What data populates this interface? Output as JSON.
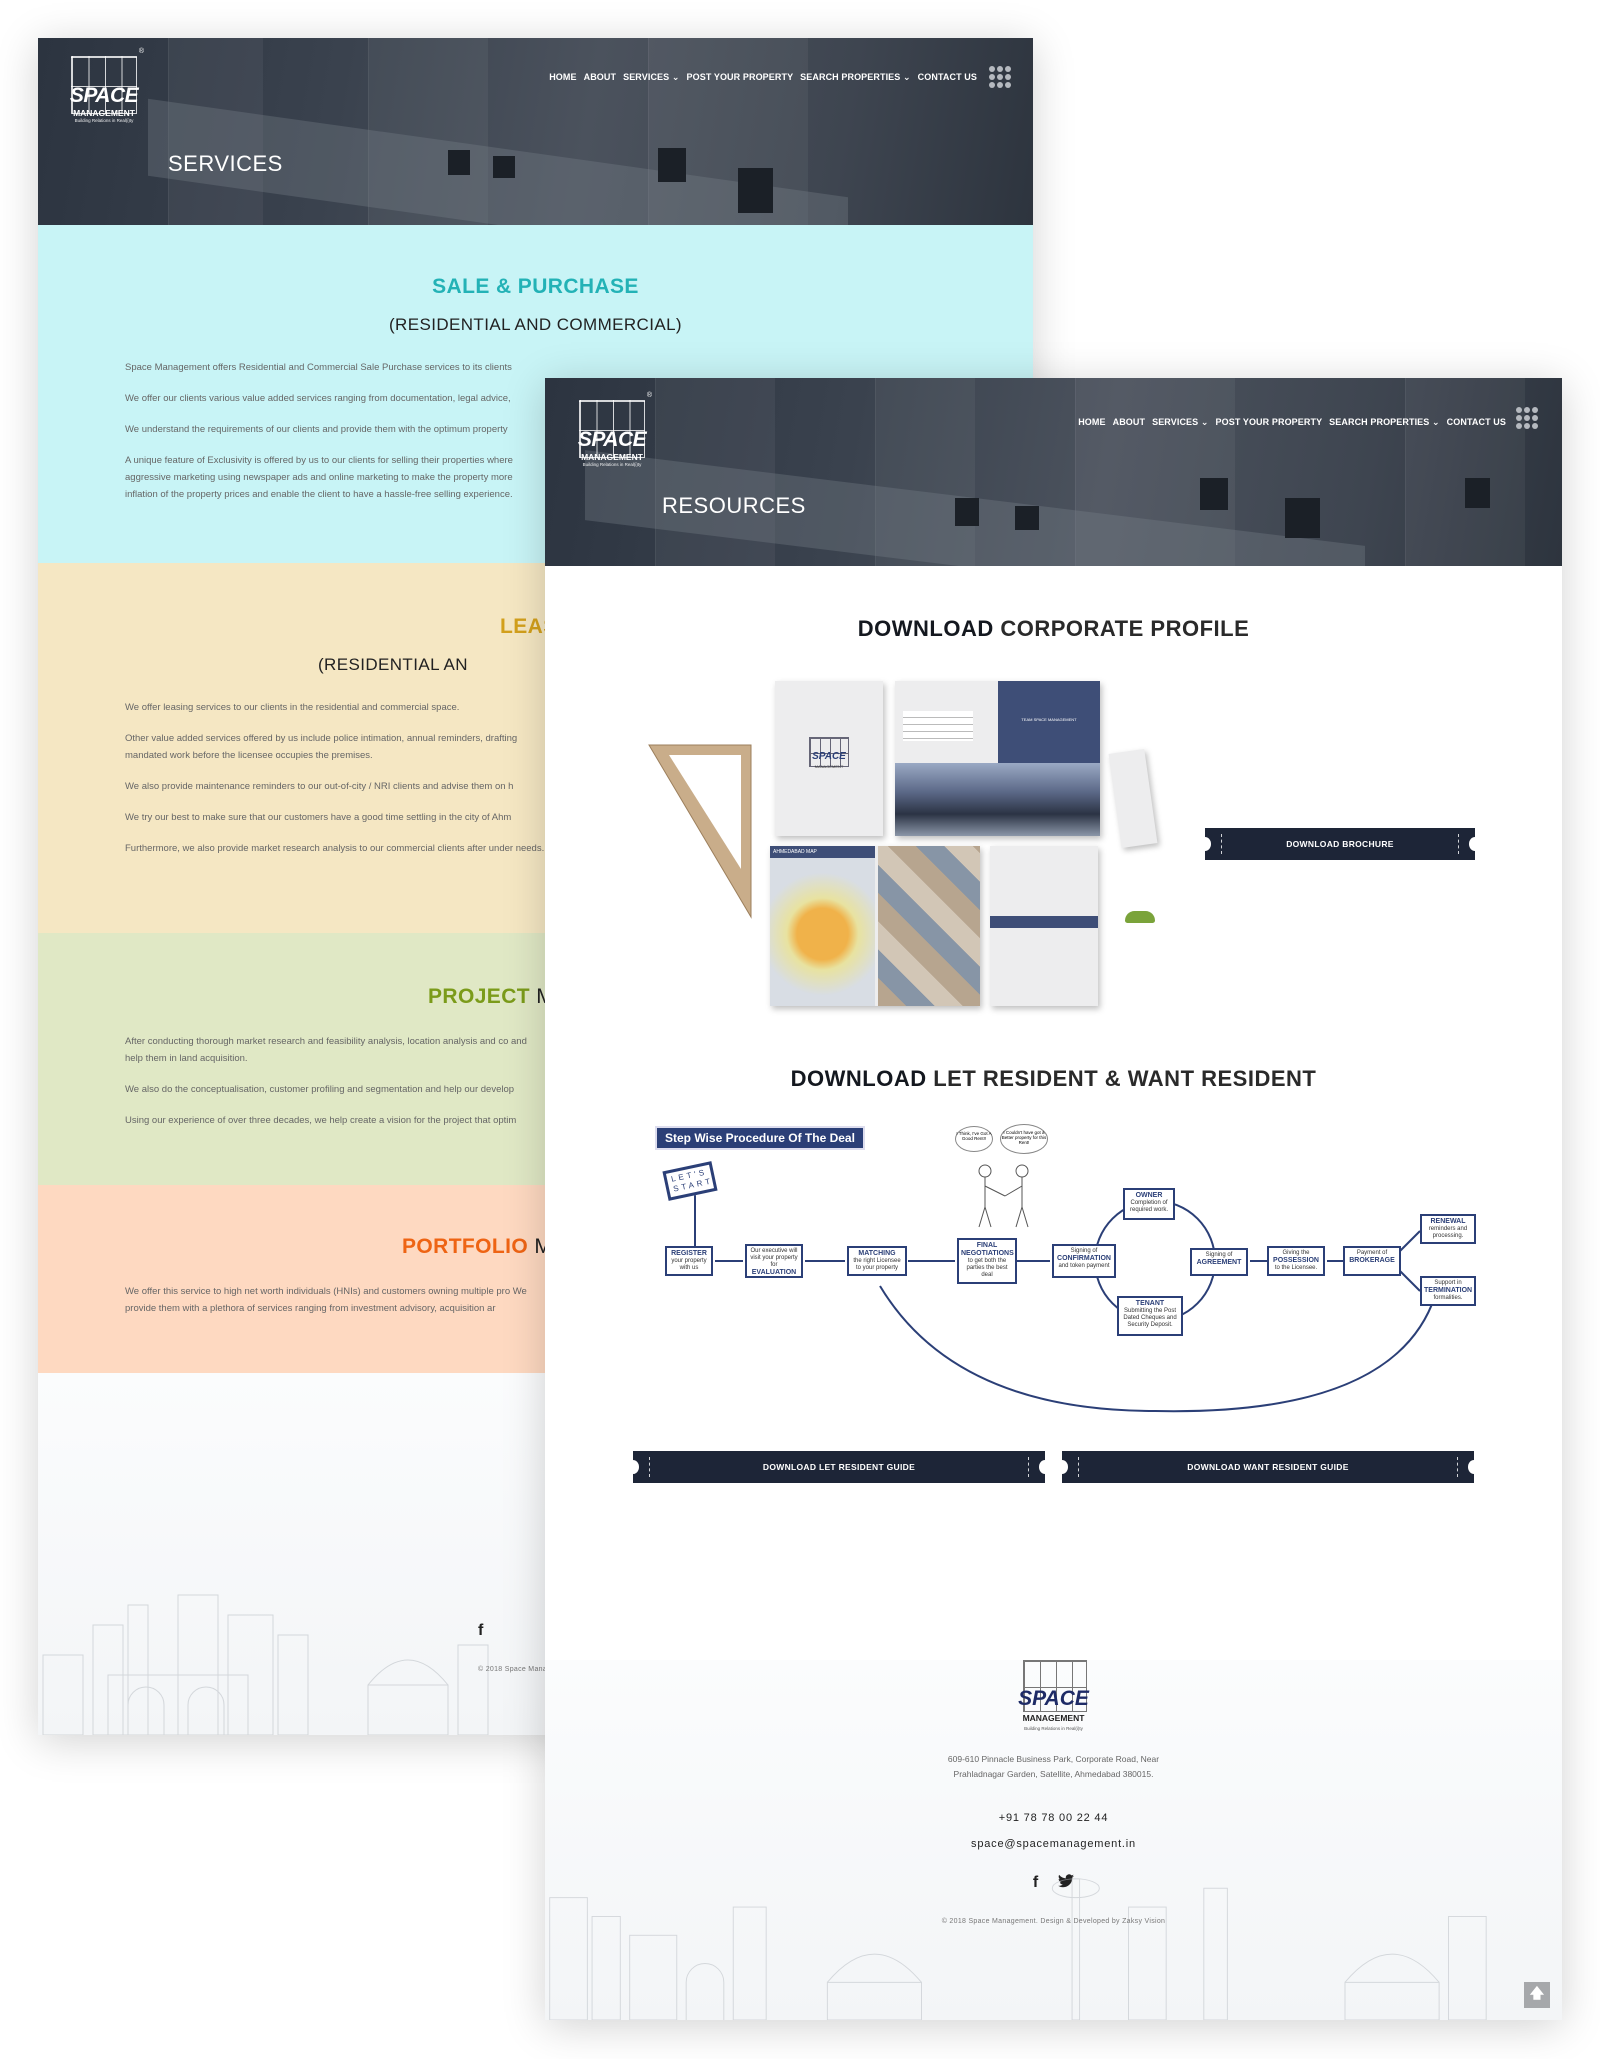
{
  "brand": {
    "name": "SPACE",
    "sub": "MANAGEMENT",
    "tagline": "Building Relations in Real(i)ty",
    "registered": "®"
  },
  "nav": {
    "items": [
      {
        "label": "HOME",
        "has_dropdown": false
      },
      {
        "label": "ABOUT",
        "has_dropdown": false
      },
      {
        "label": "SERVICES",
        "has_dropdown": true
      },
      {
        "label": "POST YOUR PROPERTY",
        "has_dropdown": false
      },
      {
        "label": "SEARCH PROPERTIES",
        "has_dropdown": true
      },
      {
        "label": "CONTACT US",
        "has_dropdown": false
      }
    ],
    "dropdown_glyph": "⌄",
    "menu_icon": "grid-dots-icon"
  },
  "services_page": {
    "hero_title": "SERVICES",
    "sections": [
      {
        "title_accent": "SALE & PURCHASE",
        "title_rest": "",
        "subtitle": "(RESIDENTIAL AND COMMERCIAL)",
        "accent_color": "#23b2b6",
        "bg_color": "#c8f4f6",
        "paragraphs": [
          "Space Management offers Residential and Commercial Sale Purchase services to its clients",
          "We offer our clients various value added services ranging from documentation, legal advice,",
          "We understand the requirements of our clients and provide them with the optimum property",
          "A unique feature of Exclusivity is offered by us to our clients for selling their properties where aggressive marketing using newspaper ads and online marketing to make the property more inflation of the property prices and enable the client to have a hassle-free selling experience."
        ]
      },
      {
        "title_accent": "LEAS",
        "title_rest": "",
        "subtitle": "(RESIDENTIAL AN",
        "accent_color": "#d3a01c",
        "bg_color": "#f5e7c3",
        "paragraphs": [
          "We offer leasing services to our clients in the residential and commercial space.",
          "Other value added services offered by us include police intimation, annual reminders, drafting mandated work before the licensee occupies the premises.",
          "We also provide maintenance reminders to our out-of-city / NRI clients and advise them on h",
          "We try our best to make sure that our customers have a good time settling in the city of Ahm",
          "Furthermore, we also provide market research analysis to our commercial clients after under needs."
        ]
      },
      {
        "title_accent": "PROJECT",
        "title_rest": "M",
        "subtitle": "",
        "accent_color": "#7b9b1a",
        "bg_color": "#e0e8c5",
        "paragraphs": [
          "After conducting thorough market research and feasibility analysis, location analysis and co and help them in land acquisition.",
          "We also do the conceptualisation, customer profiling and segmentation and help our develop",
          "Using our experience of over three decades, we help create a vision for the project that optim"
        ]
      },
      {
        "title_accent": "PORTFOLIO",
        "title_rest": "M",
        "subtitle": "",
        "accent_color": "#ee6414",
        "bg_color": "#fed9c1",
        "paragraphs": [
          "We offer this service to high net worth individuals (HNIs) and customers owning multiple pro We provide them with a plethora of services ranging from investment advisory, acquisition ar"
        ]
      }
    ],
    "footer": {
      "address_line1": "609-610 Pinnacle Business",
      "address_line2": "Prahladnagar Garden, Sate",
      "phone": "+91 78 78",
      "email": "space@spacem",
      "copyright": "© 2018 Space Management. Des"
    }
  },
  "resources_page": {
    "hero_title": "RESOURCES",
    "profile_section": {
      "title_bold": "DOWNLOAD",
      "title_rest": "CORPORATE PROFILE",
      "button_label": "DOWNLOAD BROCHURE",
      "art": {
        "cover_brand": "SPACE",
        "cover_sub": "MANAGEMENT",
        "spread_heading": "TEAM SPACE MANAGEMENT",
        "map_heading": "AHMEDABAD MAP"
      }
    },
    "resident_section": {
      "title_bold": "DOWNLOAD",
      "title_rest": "LET RESIDENT & WANT RESIDENT",
      "buttons": [
        {
          "label": "DOWNLOAD LET RESIDENT GUIDE"
        },
        {
          "label": "DOWNLOAD WANT RESIDENT GUIDE"
        }
      ],
      "diagram": {
        "title": "Step Wise Procedure Of The Deal",
        "start_stamp": "LET'S START",
        "bubble_left": "I Think, I've Got A Good Rent!!",
        "bubble_right": "I Couldn't have got a Better property for this Rent!",
        "steps": [
          {
            "key": "REGISTER",
            "pre": "",
            "post": "your property with us"
          },
          {
            "key": "EVALUATION",
            "pre": "Our executive will visit your property for",
            "post": ""
          },
          {
            "key": "MATCHING",
            "pre": "",
            "post": "the right Licensee to your property"
          },
          {
            "key": "FINAL NEGOTIATIONS",
            "pre": "",
            "post": "to get both the parties the best deal"
          },
          {
            "key": "CONFIRMATION",
            "pre": "Signing of",
            "post": "and token payment"
          },
          {
            "key": "OWNER",
            "pre": "",
            "post": "Completion of required work."
          },
          {
            "key": "TENANT",
            "pre": "",
            "post": "Submitting the Post Dated Cheques and Security Deposit."
          },
          {
            "key": "AGREEMENT",
            "pre": "Signing of",
            "post": ""
          },
          {
            "key": "POSSESSION",
            "pre": "Giving the",
            "post": "to the Licensee."
          },
          {
            "key": "BROKERAGE",
            "pre": "Payment of",
            "post": ""
          },
          {
            "key": "RENEWAL",
            "pre": "",
            "post": "reminders and processing."
          },
          {
            "key": "TERMINATION",
            "pre": "Support in",
            "post": "formalities."
          }
        ]
      }
    },
    "footer": {
      "address_line1": "609-610 Pinnacle Business Park, Corporate Road, Near",
      "address_line2": "Prahladnagar Garden, Satellite, Ahmedabad 380015.",
      "phone": "+91 78 78 00 22 44",
      "email": "space@spacemanagement.in",
      "social": [
        {
          "name": "facebook",
          "glyph": "f"
        },
        {
          "name": "twitter",
          "glyph": "🐦"
        }
      ],
      "copyright": "© 2018 Space Management. Design & Developed by Zaksy Vision",
      "scroll_top_glyph": "🡅"
    }
  },
  "colors": {
    "header_dark": "#2f3641",
    "button_navy": "#1d2537",
    "diagram_blue": "#2b3f77"
  }
}
